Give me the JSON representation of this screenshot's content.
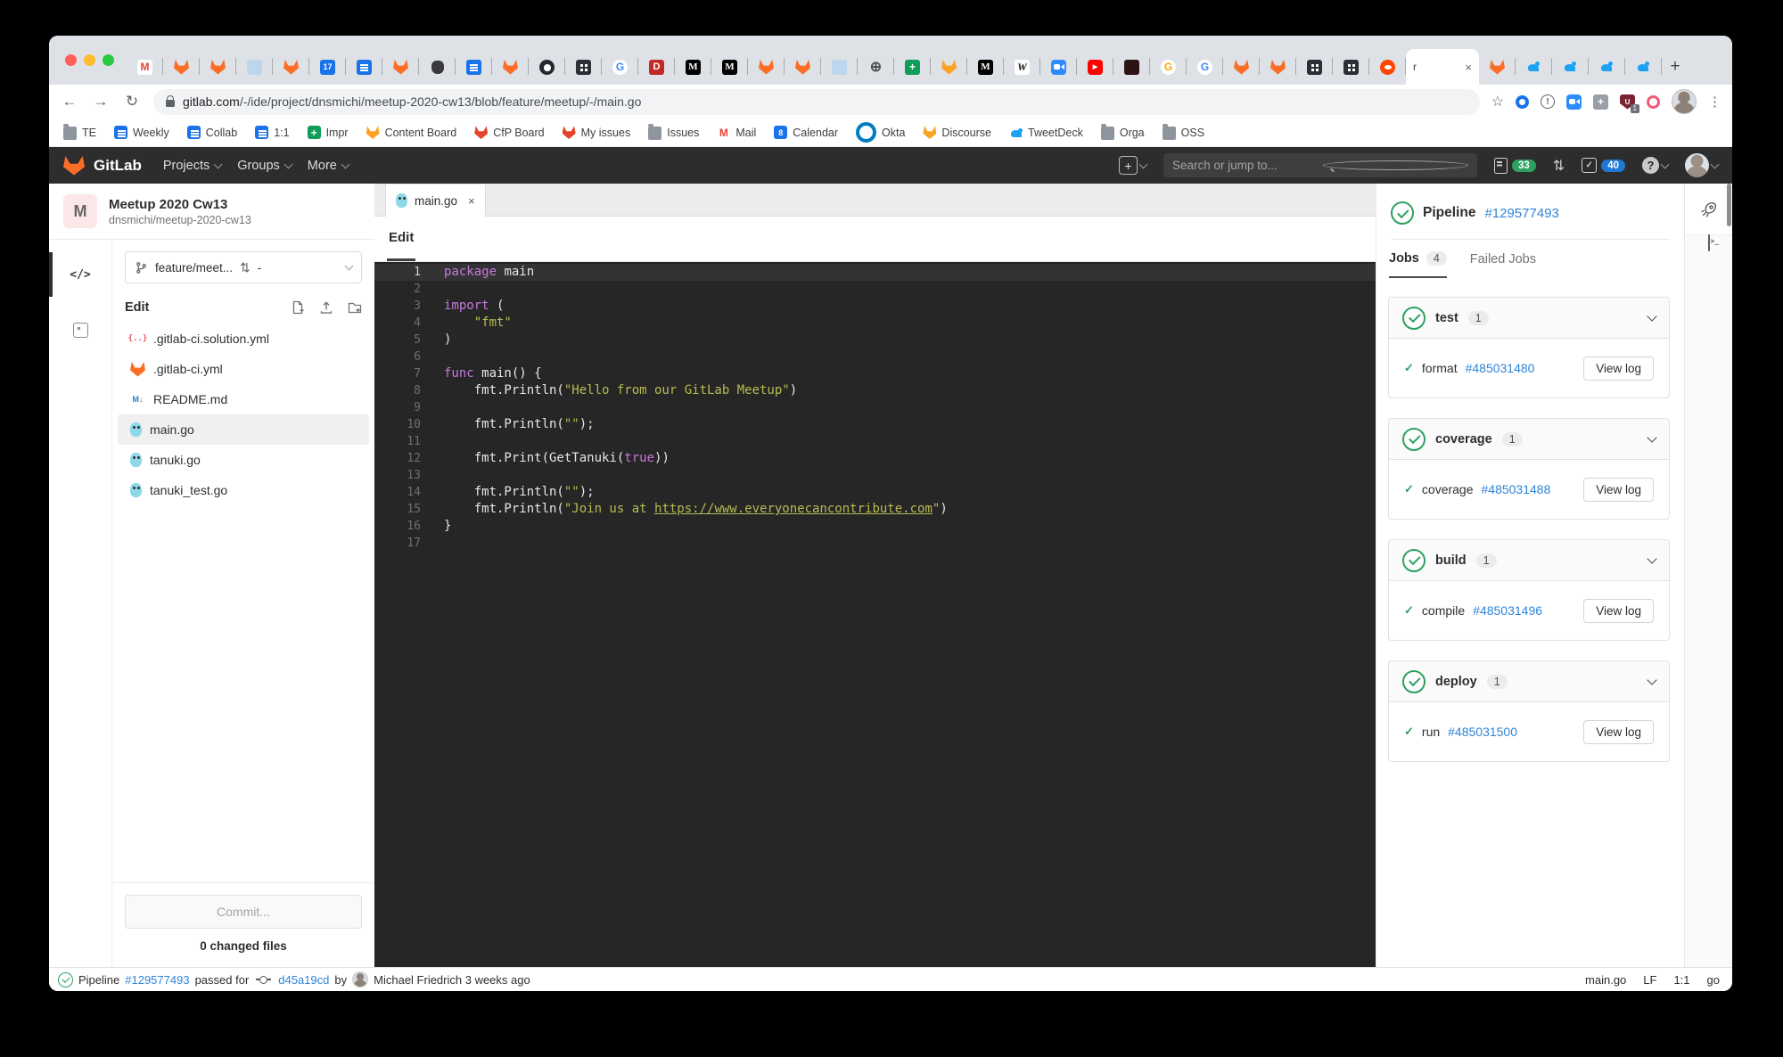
{
  "colors": {
    "traffic": [
      "#ff5f57",
      "#febc2e",
      "#28c840"
    ],
    "gitlab_orange": "#fc6d26",
    "link_blue": "#3084d8",
    "success_green": "#2da160",
    "issues_badge_green": "#2da160",
    "todos_badge_blue": "#1f78d1",
    "editor_bg": "#262626",
    "keyword": "#c678dd",
    "string": "#b8bb52"
  },
  "browser": {
    "tabs_before": [
      "gmail",
      "fox",
      "fox",
      "img",
      "fox",
      "cal17",
      "gdocs",
      "fox",
      "apple",
      "gdocs",
      "fox",
      "github",
      "grid",
      "g",
      "d",
      "m",
      "m",
      "fox",
      "fox",
      "img",
      "globe",
      "gplus",
      "foxy",
      "m",
      "w",
      "zoomc",
      "yt",
      "darksq",
      "go",
      "g",
      "fox",
      "fox",
      "grid",
      "grid",
      "reddit"
    ],
    "active_tab": {
      "label": "r",
      "close_glyph": "×"
    },
    "tabs_after": [
      "fox",
      "tw",
      "tw",
      "tw",
      "tw"
    ],
    "new_tab_glyph": "+",
    "back_glyph": "←",
    "forward_glyph": "→",
    "reload_glyph": "↻",
    "url": {
      "domain": "gitlab.com",
      "path": "/-/ide/project/dnsmichi/meetup-2020-cw13/blob/feature/meetup/-/main.go"
    },
    "star_glyph": "☆",
    "extensions": [
      "bluedot",
      "onep",
      "zoomc",
      "grayplus",
      "shield",
      "swirl"
    ],
    "extension_badge": "1",
    "kebab_glyph": "⋮",
    "favicon_glyphs": {
      "gmail": "M",
      "cal17": "17",
      "cal8": "8",
      "g": "G",
      "go": "G",
      "d": "D",
      "m": "M",
      "w": "W",
      "gplus": "+",
      "grayplus": "+",
      "yt": "▶",
      "globe": "⊕",
      "braces": "{..}",
      "md": "M↓",
      "onep": "!",
      "shield": "U"
    },
    "bookmarks": [
      {
        "icon": "folder",
        "label": "TE"
      },
      {
        "icon": "gdocs",
        "label": "Weekly"
      },
      {
        "icon": "gdocs",
        "label": "Collab"
      },
      {
        "icon": "gdocs",
        "label": "1:1"
      },
      {
        "icon": "gplus",
        "label": "Impr"
      },
      {
        "icon": "foxy",
        "label": "Content Board"
      },
      {
        "icon": "foxr",
        "label": "CfP Board"
      },
      {
        "icon": "foxr",
        "label": "My issues"
      },
      {
        "icon": "folder",
        "label": "Issues"
      },
      {
        "icon": "gmail",
        "label": "Mail"
      },
      {
        "icon": "cal8",
        "label": "Calendar"
      },
      {
        "icon": "okta",
        "label": "Okta"
      },
      {
        "icon": "foxy",
        "label": "Discourse"
      },
      {
        "icon": "tw",
        "label": "TweetDeck"
      },
      {
        "icon": "folder",
        "label": "Orga"
      },
      {
        "icon": "folder",
        "label": "OSS"
      }
    ]
  },
  "navbar": {
    "logo_text": "GitLab",
    "menus": [
      "Projects",
      "Groups",
      "More"
    ],
    "plus_glyph": "+",
    "search_placeholder": "Search or jump to...",
    "issues_count": "33",
    "mr_glyph": "⇅",
    "todos_count": "40",
    "help_glyph": "?"
  },
  "sidebar": {
    "avatar_letter": "M",
    "project_title": "Meetup 2020 Cw13",
    "project_path": "dnsmichi/meetup-2020-cw13",
    "code_rail_glyph": "</>",
    "branch_label": "feature/meet...",
    "mr_value": "-",
    "section_label": "Edit",
    "files": [
      {
        "icon": "braces",
        "name": ".gitlab-ci.solution.yml",
        "selected": false
      },
      {
        "icon": "fox",
        "name": ".gitlab-ci.yml",
        "selected": false
      },
      {
        "icon": "md",
        "name": "README.md",
        "selected": false
      },
      {
        "icon": "gopher",
        "name": "main.go",
        "selected": true
      },
      {
        "icon": "gopher",
        "name": "tanuki.go",
        "selected": false
      },
      {
        "icon": "gopher",
        "name": "tanuki_test.go",
        "selected": false
      }
    ],
    "commit_label": "Commit...",
    "changed_label": "0 changed files"
  },
  "editor": {
    "tab_name": "main.go",
    "tab_close_glyph": "×",
    "mode_label": "Edit",
    "active_line": 1,
    "lines": [
      [
        [
          "k",
          "package"
        ],
        [
          "p",
          " main"
        ]
      ],
      [],
      [
        [
          "k",
          "import"
        ],
        [
          "p",
          " ("
        ]
      ],
      [
        [
          "p",
          "    "
        ],
        [
          "s",
          "\"fmt\""
        ]
      ],
      [
        [
          "p",
          ")"
        ]
      ],
      [],
      [
        [
          "k",
          "func"
        ],
        [
          "p",
          " main() {"
        ]
      ],
      [
        [
          "p",
          "    fmt.Println("
        ],
        [
          "s",
          "\"Hello from our GitLab Meetup\""
        ],
        [
          "p",
          ")"
        ]
      ],
      [],
      [
        [
          "p",
          "    fmt.Println("
        ],
        [
          "s",
          "\"\""
        ],
        [
          "p",
          ");"
        ]
      ],
      [],
      [
        [
          "p",
          "    fmt.Print(GetTanuki("
        ],
        [
          "k",
          "true"
        ],
        [
          "p",
          "))"
        ]
      ],
      [],
      [
        [
          "p",
          "    fmt.Println("
        ],
        [
          "s",
          "\"\""
        ],
        [
          "p",
          ");"
        ]
      ],
      [
        [
          "p",
          "    fmt.Println("
        ],
        [
          "s",
          "\"Join us at "
        ],
        [
          "u",
          "https://www.everyonecancontribute.com"
        ],
        [
          "s",
          "\""
        ],
        [
          "p",
          ")"
        ]
      ],
      [
        [
          "p",
          "}"
        ]
      ],
      []
    ]
  },
  "pipeline": {
    "title": "Pipeline",
    "id": "#129577493",
    "jobs_tab": "Jobs",
    "jobs_count": "4",
    "failed_tab": "Failed Jobs",
    "stages": [
      {
        "name": "test",
        "count": "1",
        "job": "format",
        "job_id": "#485031480",
        "action": "View log"
      },
      {
        "name": "coverage",
        "count": "1",
        "job": "coverage",
        "job_id": "#485031488",
        "action": "View log"
      },
      {
        "name": "build",
        "count": "1",
        "job": "compile",
        "job_id": "#485031496",
        "action": "View log"
      },
      {
        "name": "deploy",
        "count": "1",
        "job": "run",
        "job_id": "#485031500",
        "action": "View log"
      }
    ]
  },
  "statusbar": {
    "pipeline_label": "Pipeline",
    "pipeline_id": "#129577493",
    "passed_label": "passed for",
    "commit_sha": "d45a19cd",
    "by_label": "by",
    "author": "Michael Friedrich 3 weeks ago",
    "right_items": [
      "main.go",
      "LF",
      "1:1",
      "go"
    ]
  }
}
